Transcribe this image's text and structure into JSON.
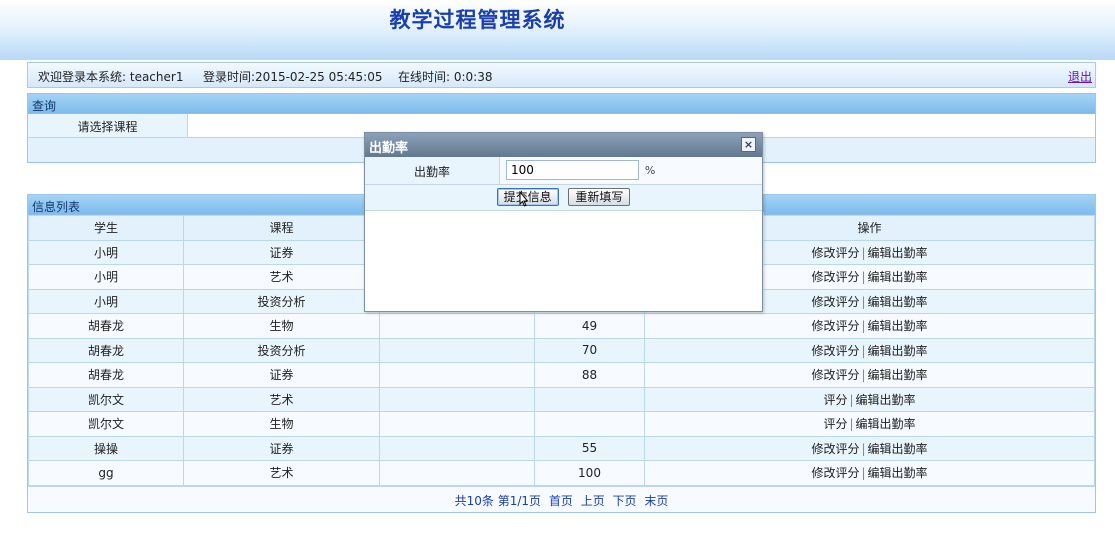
{
  "app": {
    "title": "教学过程管理系统"
  },
  "infobar": {
    "welcome": "欢迎登录本系统: teacher1",
    "login_time": "登录时间:2015-02-25 05:45:05",
    "online_time": "在线时间: 0:0:38",
    "logout": "退出"
  },
  "query": {
    "header": "查询",
    "label": "请选择课程"
  },
  "list": {
    "header": "信息列表",
    "columns": [
      "学生",
      "课程",
      "",
      "",
      "操作"
    ],
    "rows": [
      {
        "student": "小明",
        "course": "证券",
        "c3": "",
        "c4": "",
        "ops": [
          "修改评分",
          "编辑出勤率"
        ]
      },
      {
        "student": "小明",
        "course": "艺术",
        "c3": "",
        "c4": "",
        "ops": [
          "修改评分",
          "编辑出勤率"
        ]
      },
      {
        "student": "小明",
        "course": "投资分析",
        "c3": "",
        "c4": "",
        "ops": [
          "修改评分",
          "编辑出勤率"
        ]
      },
      {
        "student": "胡春龙",
        "course": "生物",
        "c3": "",
        "c4": "49",
        "ops": [
          "修改评分",
          "编辑出勤率"
        ]
      },
      {
        "student": "胡春龙",
        "course": "投资分析",
        "c3": "",
        "c4": "70",
        "ops": [
          "修改评分",
          "编辑出勤率"
        ]
      },
      {
        "student": "胡春龙",
        "course": "证券",
        "c3": "",
        "c4": "88",
        "ops": [
          "修改评分",
          "编辑出勤率"
        ]
      },
      {
        "student": "凯尔文",
        "course": "艺术",
        "c3": "",
        "c4": "",
        "ops": [
          "评分",
          "编辑出勤率"
        ]
      },
      {
        "student": "凯尔文",
        "course": "生物",
        "c3": "",
        "c4": "",
        "ops": [
          "评分",
          "编辑出勤率"
        ]
      },
      {
        "student": "操操",
        "course": "证券",
        "c3": "",
        "c4": "55",
        "ops": [
          "修改评分",
          "编辑出勤率"
        ]
      },
      {
        "student": "gg",
        "course": "艺术",
        "c3": "",
        "c4": "100",
        "ops": [
          "修改评分",
          "编辑出勤率"
        ]
      }
    ],
    "pager": {
      "summary": "共10条 第1/1页",
      "first": "首页",
      "prev": "上页",
      "next": "下页",
      "last": "末页"
    }
  },
  "dialog": {
    "title": "出勤率",
    "close": "×",
    "field_label": "出勤率",
    "field_value": "100",
    "unit": "%",
    "submit": "提交信息",
    "reset": "重新填写"
  }
}
